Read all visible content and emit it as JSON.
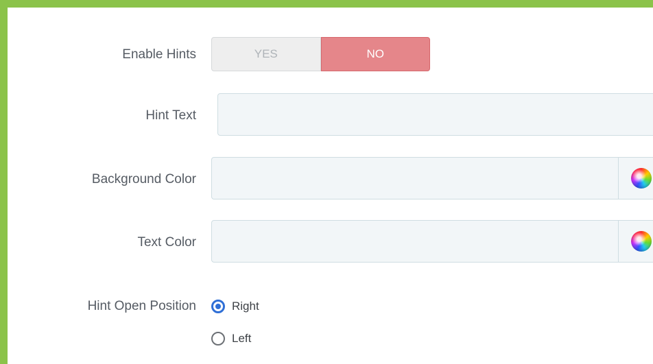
{
  "form": {
    "enable_hints": {
      "label": "Enable Hints",
      "yes": "YES",
      "no": "NO",
      "selected": "NO"
    },
    "hint_text": {
      "label": "Hint Text",
      "value": ""
    },
    "background_color": {
      "label": "Background Color",
      "value": "",
      "picker_icon": "color-wheel-icon"
    },
    "text_color": {
      "label": "Text Color",
      "value": "",
      "picker_icon": "color-wheel-icon"
    },
    "hint_open_position": {
      "label": "Hint Open Position",
      "options": [
        {
          "label": "Right",
          "checked": true
        },
        {
          "label": "Left",
          "checked": false
        }
      ]
    }
  },
  "colors": {
    "frame": "#8bc34a",
    "no_active": "#e5868a",
    "radio_accent": "#2f6fd6"
  }
}
